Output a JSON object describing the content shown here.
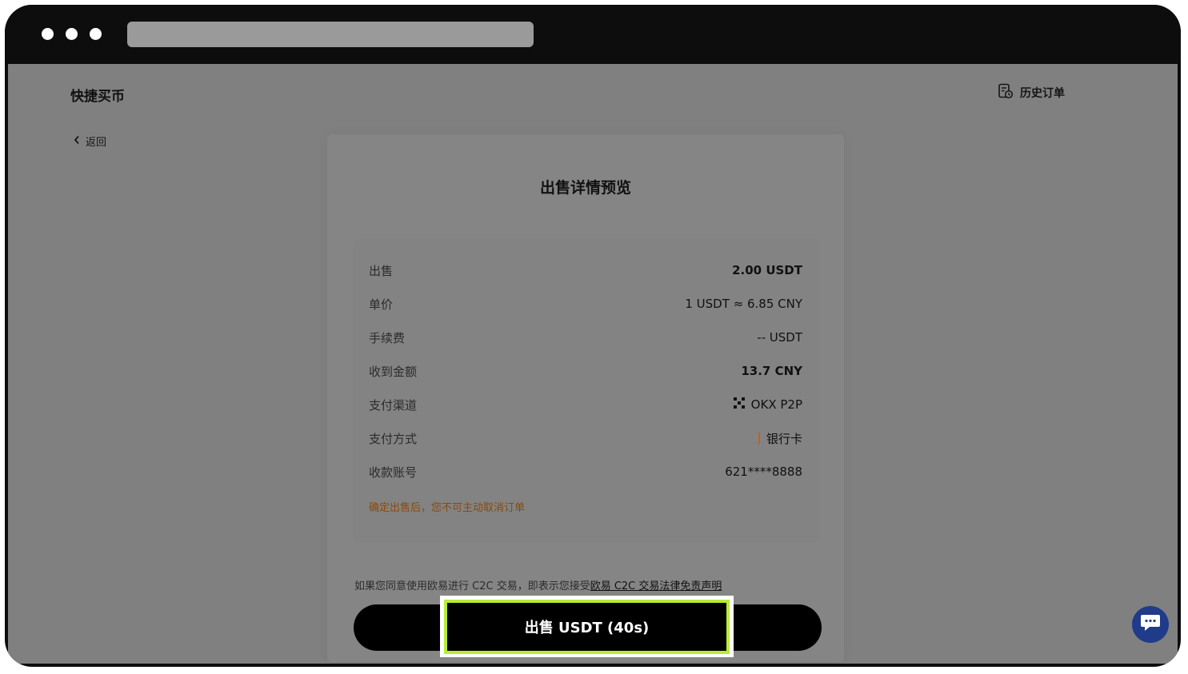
{
  "header": {
    "brand": "快捷买币",
    "history_label": "历史订单",
    "back_label": "返回"
  },
  "card": {
    "title": "出售详情预览",
    "rows": [
      {
        "key": "出售",
        "value": "2.00 USDT",
        "bold": true
      },
      {
        "key": "单价",
        "value": "1 USDT ≈ 6.85 CNY"
      },
      {
        "key": "手续费",
        "value": "-- USDT"
      },
      {
        "key": "收到金额",
        "value": "13.7 CNY",
        "bold": true
      },
      {
        "key": "支付渠道",
        "value": "OKX P2P",
        "icon": "okx-logo-icon"
      },
      {
        "key": "支付方式",
        "value": "银行卡",
        "icon": "bank-card-indicator"
      },
      {
        "key": "收款账号",
        "value": "621****8888"
      }
    ],
    "warning": "确定出售后，您不可主动取消订单"
  },
  "disclaimer": {
    "text": "如果您同意使用欧易进行 C2C 交易，即表示您接受",
    "link": "欧易 C2C 交易法律免责声明"
  },
  "action": {
    "sell_label": "出售 USDT (40s)"
  },
  "colors": {
    "highlight": "#b7ec36",
    "warning": "#8a4a0b",
    "chat": "#1f3b8a"
  }
}
